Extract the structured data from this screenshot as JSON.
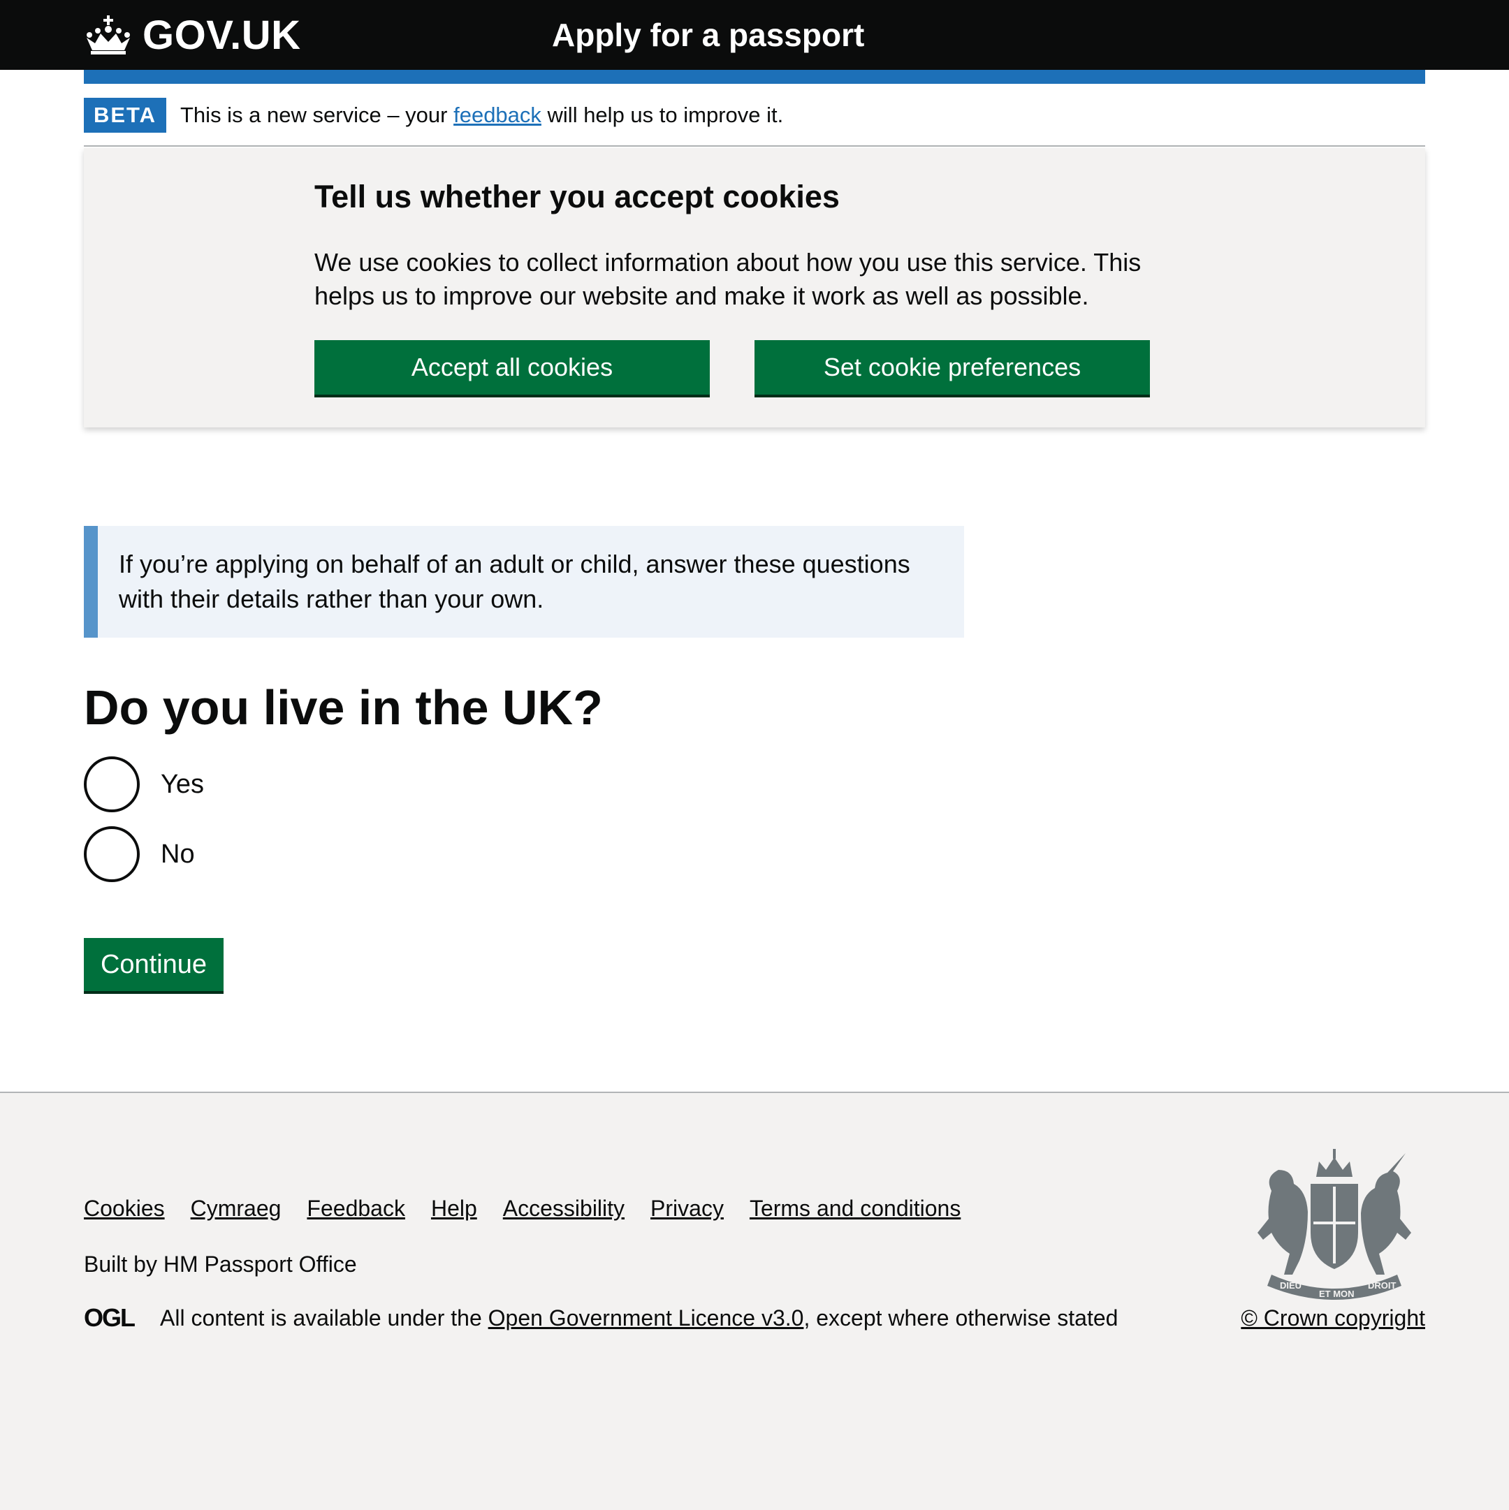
{
  "header": {
    "logo_text": "GOV.UK",
    "service_name": "Apply for a passport"
  },
  "phase_banner": {
    "tag": "BETA",
    "text_before": "This is a new service – your ",
    "link_text": "feedback",
    "text_after": " will help us to improve it."
  },
  "cookie_banner": {
    "heading": "Tell us whether you accept cookies",
    "body": "We use cookies to collect information about how you use this service. This helps us to improve our website and make it work as well as possible.",
    "accept_label": "Accept all cookies",
    "preferences_label": "Set cookie preferences"
  },
  "main": {
    "inset_text": "If you’re applying on behalf of an adult or child, answer these questions with their details rather than your own.",
    "question": "Do you live in the UK?",
    "options": [
      {
        "label": "Yes",
        "selected": false
      },
      {
        "label": "No",
        "selected": false
      }
    ],
    "continue_label": "Continue"
  },
  "footer": {
    "links": [
      "Cookies",
      "Cymraeg",
      "Feedback",
      "Help",
      "Accessibility",
      "Privacy",
      "Terms and conditions"
    ],
    "built_by": "Built by HM Passport Office",
    "ogl_logo_text": "OGL",
    "crest_text": [
      "DIEU",
      "ET MON",
      "DROIT"
    ],
    "licence_before": "All content is available under the ",
    "licence_link": "Open Government Licence v3.0",
    "licence_after": ", except where otherwise stated",
    "copyright": "© Crown copyright"
  },
  "colors": {
    "header_bg": "#0b0c0c",
    "brand_blue": "#1d70b8",
    "button_green": "#00703c",
    "footer_bg": "#f3f2f1",
    "inset_border": "#5694ca"
  }
}
